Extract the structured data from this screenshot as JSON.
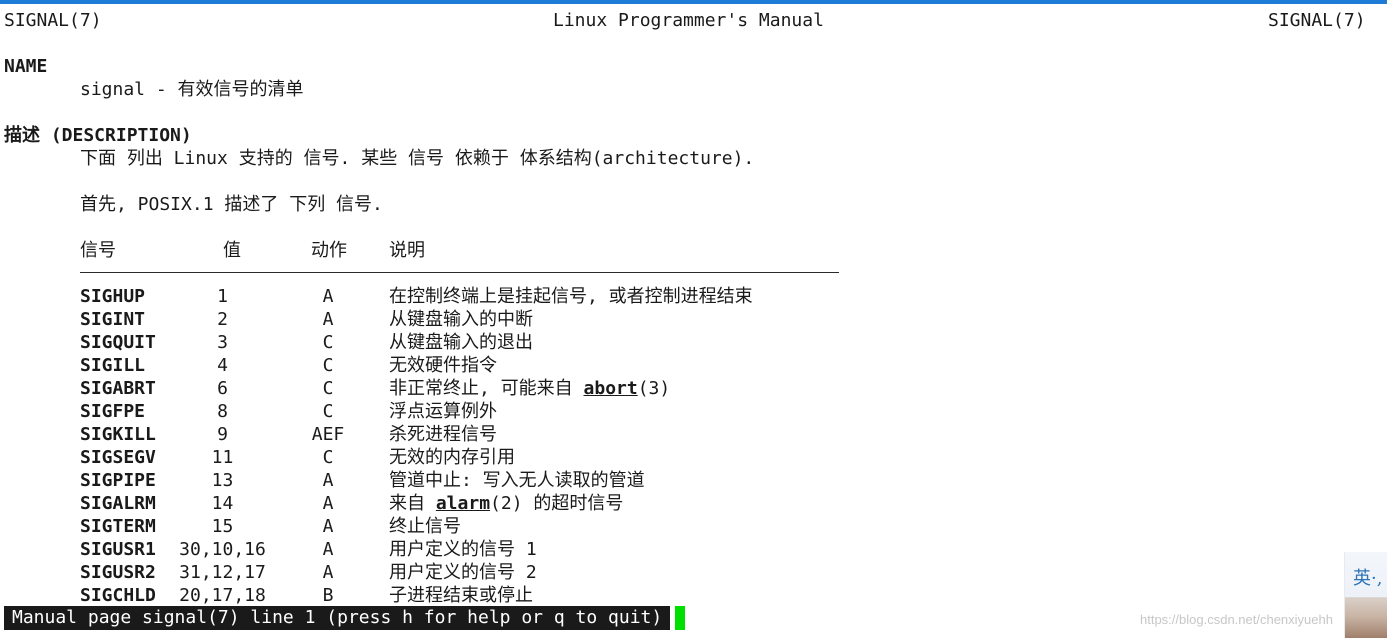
{
  "header": {
    "left": "SIGNAL(7)",
    "center": "Linux Programmer's Manual",
    "right": "SIGNAL(7)"
  },
  "sections": {
    "name_heading": "NAME",
    "name_text": "signal - 有效信号的清单",
    "desc_heading": "描述 (DESCRIPTION)",
    "desc_text_1": "下面 列出 Linux 支持的 信号. 某些 信号 依赖于 体系结构(architecture).",
    "desc_text_2": "首先, POSIX.1 描述了 下列 信号."
  },
  "table": {
    "headers": {
      "signal": "信号",
      "value": "值",
      "action": "动作",
      "comment": "说明"
    },
    "rows": [
      {
        "signal": "SIGHUP",
        "value": "1",
        "action": "A",
        "comment": "在控制终端上是挂起信号, 或者控制进程结束"
      },
      {
        "signal": "SIGINT",
        "value": "2",
        "action": "A",
        "comment": "从键盘输入的中断"
      },
      {
        "signal": "SIGQUIT",
        "value": "3",
        "action": "C",
        "comment": "从键盘输入的退出"
      },
      {
        "signal": "SIGILL",
        "value": "4",
        "action": "C",
        "comment": "无效硬件指令"
      },
      {
        "signal": "SIGABRT",
        "value": "6",
        "action": "C",
        "comment_pre": "非正常终止, 可能来自 ",
        "comment_link": "abort",
        "comment_post": "(3)"
      },
      {
        "signal": "SIGFPE",
        "value": "8",
        "action": "C",
        "comment": "浮点运算例外"
      },
      {
        "signal": "SIGKILL",
        "value": "9",
        "action": "AEF",
        "comment": "杀死进程信号"
      },
      {
        "signal": "SIGSEGV",
        "value": "11",
        "action": "C",
        "comment": "无效的内存引用"
      },
      {
        "signal": "SIGPIPE",
        "value": "13",
        "action": "A",
        "comment": "管道中止: 写入无人读取的管道"
      },
      {
        "signal": "SIGALRM",
        "value": "14",
        "action": "A",
        "comment_pre": "来自 ",
        "comment_link": "alarm",
        "comment_post": "(2) 的超时信号"
      },
      {
        "signal": "SIGTERM",
        "value": "15",
        "action": "A",
        "comment": "终止信号"
      },
      {
        "signal": "SIGUSR1",
        "value": "30,10,16",
        "action": "A",
        "comment": "用户定义的信号 1"
      },
      {
        "signal": "SIGUSR2",
        "value": "31,12,17",
        "action": "A",
        "comment": "用户定义的信号 2"
      },
      {
        "signal": "SIGCHLD",
        "value": "20,17,18",
        "action": "B",
        "comment": "子进程结束或停止"
      }
    ]
  },
  "status_bar": {
    "text": "Manual page signal(7) line 1 (press h for help or q to quit)",
    "cursor_color": "#00e000"
  },
  "overlay": {
    "watermark": "https://blog.csdn.net/chenxiyuehh",
    "avatar_text": "英·,"
  }
}
